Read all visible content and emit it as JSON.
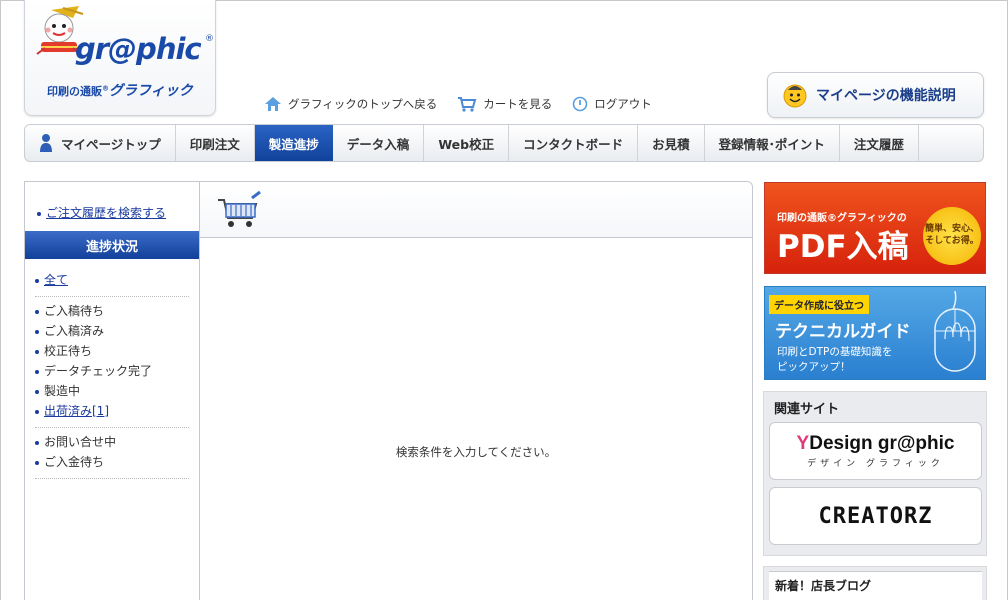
{
  "brand": {
    "logo_word": "gr@phic",
    "logo_reg": "®",
    "logo_sub_small": "印刷の通販",
    "logo_sub_reg": "®",
    "logo_sub_big": "グラフィック",
    "color_primary": "#1a4aa8"
  },
  "toplinks": [
    {
      "label": "グラフィックのトップへ戻る",
      "icon": "home-icon"
    },
    {
      "label": "カートを見る",
      "icon": "cart-icon"
    },
    {
      "label": "ログアウト",
      "icon": "power-icon"
    }
  ],
  "mypage_help": {
    "label": "マイページの機能説明",
    "icon": "smiley-icon"
  },
  "nav": {
    "items": [
      {
        "label": "マイページトップ",
        "active": false
      },
      {
        "label": "印刷注文",
        "active": false
      },
      {
        "label": "製造進捗",
        "active": true
      },
      {
        "label": "データ入稿",
        "active": false
      },
      {
        "label": "Web校正",
        "active": false
      },
      {
        "label": "コンタクトボード",
        "active": false
      },
      {
        "label": "お見積",
        "active": false
      },
      {
        "label": "登録情報･ポイント",
        "active": false
      },
      {
        "label": "注文履歴",
        "active": false
      }
    ],
    "active_color": "#1a4fb0"
  },
  "sidebar": {
    "search_link": "ご注文履歴を検索する",
    "status_heading": "進捗状況",
    "groups": [
      [
        {
          "label": "全て",
          "link": true
        }
      ],
      [
        {
          "label": "ご入稿待ち",
          "link": false
        },
        {
          "label": "ご入稿済み",
          "link": false
        },
        {
          "label": "校正待ち",
          "link": false
        },
        {
          "label": "データチェック完了",
          "link": false
        },
        {
          "label": "製造中",
          "link": false
        },
        {
          "label": "出荷済み[1]",
          "link": true
        }
      ],
      [
        {
          "label": "お問い合せ中",
          "link": false
        },
        {
          "label": "ご入金待ち",
          "link": false
        }
      ]
    ]
  },
  "main": {
    "header_icon": "cart-icon",
    "empty_message": "検索条件を入力してください。"
  },
  "banners": {
    "pdf": {
      "sub": "印刷の通販®グラフィックの",
      "big": "PDF入稿",
      "badge": "簡単、安心、そしてお得。"
    },
    "tech": {
      "tag": "データ作成に役立つ",
      "title": "テクニカルガイド",
      "desc_line1": "印刷とDTPの基礎知識を",
      "desc_line2": "ピックアップ！"
    }
  },
  "related": {
    "title": "関連サイト",
    "design_graphic": {
      "title_lead": "Y",
      "title_rest": "Design gr@phic",
      "kana": "デザイン グラフィック"
    },
    "creatorz": {
      "title": "CREATORZ"
    }
  },
  "blog": {
    "title": "新着！店長ブログ"
  }
}
